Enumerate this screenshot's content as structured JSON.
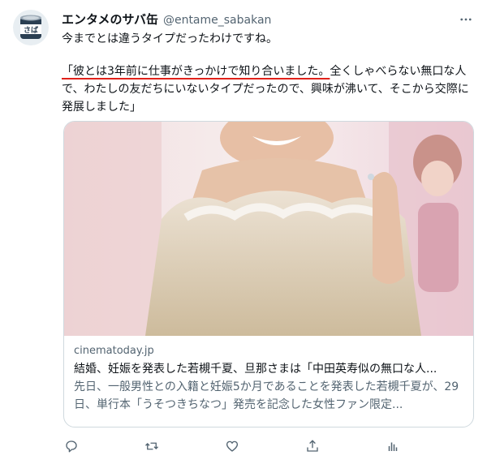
{
  "author": {
    "display_name": "エンタメのサバ缶",
    "handle": "@entame_sabakan",
    "avatar_label": "さば"
  },
  "tweet": {
    "line1": "今までとは違うタイプだったわけですね。",
    "quote_highlight": "「彼とは3年前に仕事がきっかけで知り合いました。",
    "quote_rest": "全くしゃべらない無口な人で、わたしの友だちにいないタイプだったので、興味が沸いて、そこから交際に発展しました」"
  },
  "card": {
    "domain": "cinematoday.jp",
    "title": "結婚、妊娠を発表した若槻千夏、旦那さまは「中田英寿似の無口な人...",
    "description": "先日、一般男性との入籍と妊娠5か月であることを発表した若槻千夏が、29日、単行本「うそつきちなつ」発売を記念した女性ファン限定..."
  },
  "colors": {
    "text": "#0f1419",
    "secondary": "#536471",
    "border": "#cfd9de",
    "underline": "#e0211a"
  },
  "icons": [
    "more-icon",
    "reply-icon",
    "retweet-icon",
    "like-icon",
    "share-icon",
    "views-icon"
  ]
}
